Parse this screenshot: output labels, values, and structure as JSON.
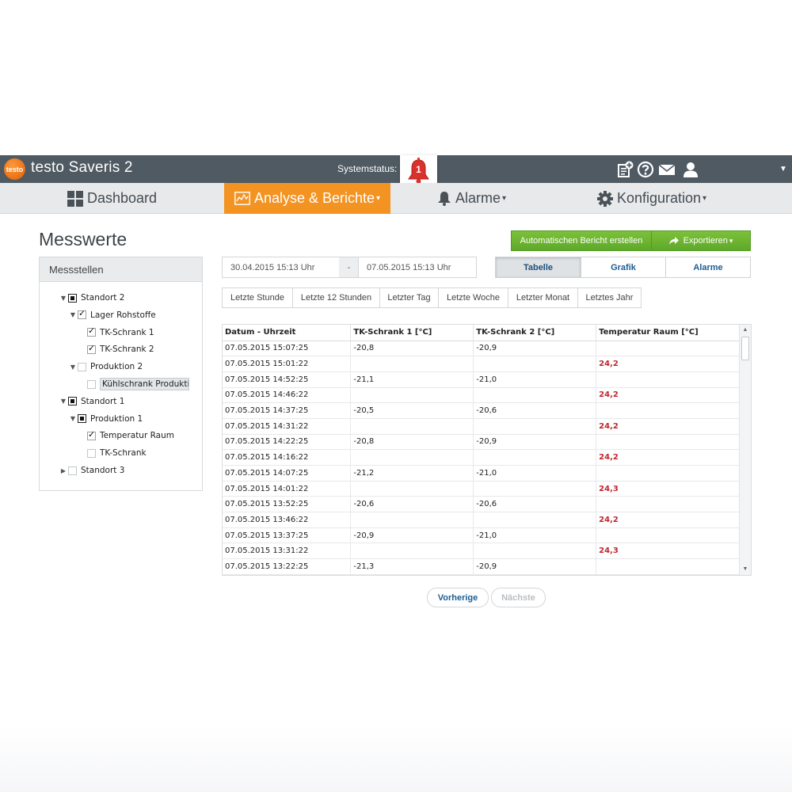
{
  "app": {
    "logo_text": "testo",
    "title": "testo Saveris 2",
    "system_status_label": "Systemstatus:",
    "alarm_count": "1"
  },
  "nav": {
    "dashboard": "Dashboard",
    "analysis": "Analyse & Berichte",
    "alarms": "Alarme",
    "config": "Konfiguration"
  },
  "page": {
    "title": "Messwerte"
  },
  "panel": {
    "title": "Messstellen",
    "tree": [
      {
        "label": "Standort 2",
        "state": "partial",
        "expanded": true,
        "level": 0
      },
      {
        "label": "Lager Rohstoffe",
        "state": "checked",
        "expanded": true,
        "level": 1
      },
      {
        "label": "TK-Schrank 1",
        "state": "checked",
        "level": 2
      },
      {
        "label": "TK-Schrank 2",
        "state": "checked",
        "level": 2
      },
      {
        "label": "Produktion 2",
        "state": "unchecked",
        "expanded": true,
        "level": 1
      },
      {
        "label": "Kühlschrank Produktion",
        "state": "unchecked",
        "level": 2,
        "selected": true
      },
      {
        "label": "Standort 1",
        "state": "partial",
        "expanded": true,
        "level": 0
      },
      {
        "label": "Produktion 1",
        "state": "partial",
        "expanded": true,
        "level": 1
      },
      {
        "label": "Temperatur Raum",
        "state": "checked",
        "level": 2
      },
      {
        "label": "TK-Schrank",
        "state": "unchecked",
        "level": 2
      },
      {
        "label": "Standort 3",
        "state": "unchecked",
        "expanded": false,
        "level": 0
      }
    ]
  },
  "daterange": {
    "from": "30.04.2015 15:13 Uhr",
    "separator": "-",
    "to": "07.05.2015 15:13 Uhr"
  },
  "actions": {
    "auto_report": "Automatischen Bericht erstellen",
    "export": "Exportieren"
  },
  "views": {
    "table": "Tabelle",
    "chart": "Grafik",
    "alarms": "Alarme"
  },
  "quick_ranges": [
    "Letzte Stunde",
    "Letzte 12 Stunden",
    "Letzter Tag",
    "Letzte Woche",
    "Letzter Monat",
    "Letztes Jahr"
  ],
  "table": {
    "headers": [
      "Datum - Uhrzeit",
      "TK-Schrank 1 [°C]",
      "TK-Schrank 2 [°C]",
      "Temperatur Raum [°C]"
    ],
    "rows": [
      [
        "07.05.2015 15:07:25",
        "-20,8",
        "-20,9",
        ""
      ],
      [
        "07.05.2015 15:01:22",
        "",
        "",
        "24,2"
      ],
      [
        "07.05.2015 14:52:25",
        "-21,1",
        "-21,0",
        ""
      ],
      [
        "07.05.2015 14:46:22",
        "",
        "",
        "24,2"
      ],
      [
        "07.05.2015 14:37:25",
        "-20,5",
        "-20,6",
        ""
      ],
      [
        "07.05.2015 14:31:22",
        "",
        "",
        "24,2"
      ],
      [
        "07.05.2015 14:22:25",
        "-20,8",
        "-20,9",
        ""
      ],
      [
        "07.05.2015 14:16:22",
        "",
        "",
        "24,2"
      ],
      [
        "07.05.2015 14:07:25",
        "-21,2",
        "-21,0",
        ""
      ],
      [
        "07.05.2015 14:01:22",
        "",
        "",
        "24,3"
      ],
      [
        "07.05.2015 13:52:25",
        "-20,6",
        "-20,6",
        ""
      ],
      [
        "07.05.2015 13:46:22",
        "",
        "",
        "24,2"
      ],
      [
        "07.05.2015 13:37:25",
        "-20,9",
        "-21,0",
        ""
      ],
      [
        "07.05.2015 13:31:22",
        "",
        "",
        "24,3"
      ],
      [
        "07.05.2015 13:22:25",
        "-21,3",
        "-20,9",
        ""
      ]
    ]
  },
  "pager": {
    "prev": "Vorherige",
    "next": "Nächste"
  },
  "colors": {
    "accent": "#f39322",
    "topbar": "#4f5a62",
    "green": "#6cb332",
    "alarm_red": "#c0262d",
    "link_blue": "#1d5d93"
  }
}
